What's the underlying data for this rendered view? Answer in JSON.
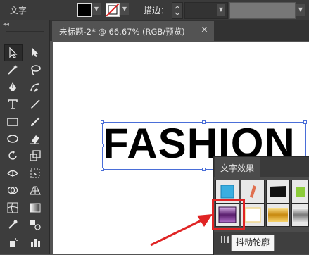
{
  "control_bar": {
    "type_label": "文字",
    "fill_color": "#000000",
    "stroke_label": "描边：",
    "dropdown_glyph": "▼"
  },
  "tools_panel": {
    "collapse_glyph": "◂◂",
    "tools": [
      "selection",
      "direct-selection",
      "magic-wand",
      "lasso",
      "pen",
      "curvature",
      "type",
      "line-segment",
      "rectangle",
      "paintbrush",
      "ellipse",
      "eraser",
      "rotate",
      "scale",
      "width",
      "free-transform",
      "shape-builder",
      "perspective-grid",
      "mesh",
      "gradient",
      "eyedropper",
      "blend",
      "symbol-sprayer",
      "column-graph"
    ]
  },
  "document": {
    "tab_title": "未标题-2* @ 66.67% (RGB/预览)",
    "close_glyph": "×"
  },
  "artboard": {
    "text": "FASHION"
  },
  "graphic_styles_panel": {
    "tab_label": "文字效果",
    "swatches": [
      "blue-cube",
      "red-ribbon",
      "black-brush",
      "green-square",
      "purple-chrome",
      "white-outline",
      "gold-gradient",
      "silver-gradient"
    ],
    "tooltip": "抖动轮廓"
  },
  "colors": {
    "highlight": "#e02424",
    "selection": "#4a6ed8"
  }
}
